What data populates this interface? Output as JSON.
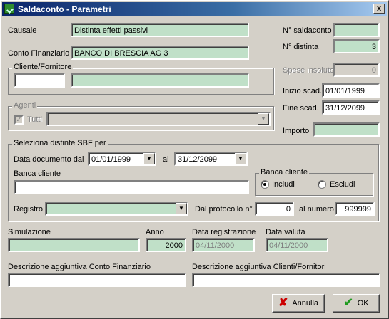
{
  "window": {
    "title": "Saldaconto - Parametri",
    "close_glyph": "x"
  },
  "causale": {
    "label": "Causale",
    "value": "Distinta effetti passivi"
  },
  "conto_finanziario": {
    "label": "Conto Finanziario",
    "value": "BANCO DI BRESCIA AG 3"
  },
  "n_saldaconto": {
    "label": "N° saldaconto",
    "value": ""
  },
  "n_distinta": {
    "label": "N° distinta",
    "value": "3"
  },
  "cliente_fornitore": {
    "group_label": "Cliente/Fornitore",
    "code": "",
    "name": ""
  },
  "spese_insoluto": {
    "label": "Spese insoluto",
    "value": "0"
  },
  "inizio_scad": {
    "label": "Inizio scad.",
    "value": "01/01/1999"
  },
  "fine_scad": {
    "label": "Fine scad.",
    "value": "31/12/2099"
  },
  "importo": {
    "label": "Importo",
    "value": ""
  },
  "agenti": {
    "group_label": "Agenti",
    "tutti_label": "Tutti",
    "tutti_checked": true,
    "selected": ""
  },
  "sbf": {
    "group_label": "Seleziona distinte SBF per",
    "data_doc_label": "Data documento dal",
    "data_dal": "01/01/1999",
    "al_label": "al",
    "data_al": "31/12/2099",
    "banca_cliente_label": "Banca cliente",
    "banca_cliente_value": "",
    "banca_radio_group_label": "Banca cliente",
    "includi_label": "Includi",
    "escludi_label": "Escludi",
    "includi_selected": true,
    "registro_label": "Registro",
    "registro_value": "",
    "dal_protocollo_label": "Dal protocollo n°",
    "dal_protocollo_value": "0",
    "al_numero_label": "al numero",
    "al_numero_value": "999999"
  },
  "simulazione": {
    "label": "Simulazione",
    "value": ""
  },
  "anno": {
    "label": "Anno",
    "value": "2000"
  },
  "data_registrazione": {
    "label": "Data registrazione",
    "value": "04/11/2000"
  },
  "data_valuta": {
    "label": "Data valuta",
    "value": "04/11/2000"
  },
  "desc_conto": {
    "label": "Descrizione aggiuntiva Conto Finanziario",
    "value": ""
  },
  "desc_clienti": {
    "label": "Descrizione aggiuntiva Clienti/Fornitori",
    "value": ""
  },
  "buttons": {
    "annulla": "Annulla",
    "ok": "OK"
  },
  "colors": {
    "field_green": "#c0e0c8",
    "face": "#d4d0c8",
    "title_start": "#0a246a",
    "title_end": "#a6caf0"
  },
  "icons": {
    "app": "saldaconto-app-icon",
    "close": "close-icon",
    "cancel": "x-cancel-icon",
    "ok": "checkmark-icon",
    "dropdown": "chevron-down-icon"
  }
}
